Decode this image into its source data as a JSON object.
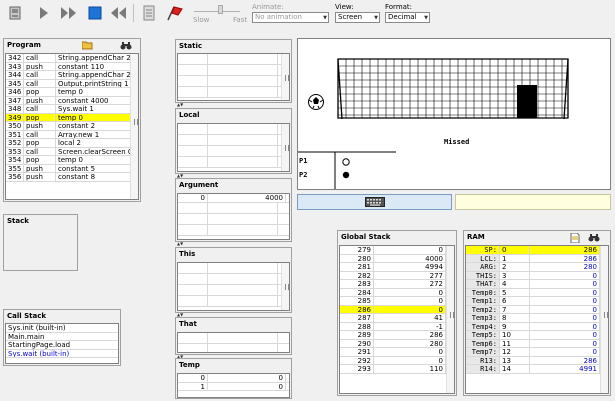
{
  "toolbar": {
    "buttons": [
      {
        "name": "load-program-button",
        "icon": "load-icon"
      },
      {
        "name": "single-step-button",
        "icon": "step-icon"
      },
      {
        "name": "fast-forward-button",
        "icon": "fast-forward-icon"
      },
      {
        "name": "stop-button",
        "icon": "stop-icon"
      },
      {
        "name": "rewind-button",
        "icon": "rewind-icon"
      },
      {
        "name": "script-button",
        "icon": "script-icon"
      },
      {
        "name": "breakpoints-button",
        "icon": "flag-icon"
      }
    ],
    "slow_label": "Slow",
    "fast_label": "Fast",
    "animate_label": "Animate:",
    "animate_value": "No animation",
    "view_label": "View:",
    "view_value": "Screen",
    "format_label": "Format:",
    "format_value": "Decimal"
  },
  "program": {
    "title": "Program",
    "rows": [
      {
        "n": "342",
        "cmd": "call",
        "arg": "String.appendChar 2",
        "hl": false
      },
      {
        "n": "343",
        "cmd": "push",
        "arg": "constant 110",
        "hl": false
      },
      {
        "n": "344",
        "cmd": "call",
        "arg": "String.appendChar 2",
        "hl": false
      },
      {
        "n": "345",
        "cmd": "call",
        "arg": "Output.printString 1",
        "hl": false
      },
      {
        "n": "346",
        "cmd": "pop",
        "arg": "temp 0",
        "hl": false
      },
      {
        "n": "347",
        "cmd": "push",
        "arg": "constant 4000",
        "hl": false
      },
      {
        "n": "348",
        "cmd": "call",
        "arg": "Sys.wait 1",
        "hl": false
      },
      {
        "n": "349",
        "cmd": "pop",
        "arg": "temp 0",
        "hl": true
      },
      {
        "n": "350",
        "cmd": "push",
        "arg": "constant 2",
        "hl": false
      },
      {
        "n": "351",
        "cmd": "call",
        "arg": "Array.new 1",
        "hl": false
      },
      {
        "n": "352",
        "cmd": "pop",
        "arg": "local 2",
        "hl": false
      },
      {
        "n": "353",
        "cmd": "call",
        "arg": "Screen.clearScreen 0",
        "hl": false
      },
      {
        "n": "354",
        "cmd": "pop",
        "arg": "temp 0",
        "hl": false
      },
      {
        "n": "355",
        "cmd": "push",
        "arg": "constant 5",
        "hl": false
      },
      {
        "n": "356",
        "cmd": "push",
        "arg": "constant 8",
        "hl": false
      }
    ]
  },
  "stack": {
    "title": "Stack"
  },
  "call_stack": {
    "title": "Call Stack",
    "items": [
      {
        "t": "Sys.init (built-in)",
        "blue": false
      },
      {
        "t": "Main.main",
        "blue": false
      },
      {
        "t": "StartingPage.load",
        "blue": false
      },
      {
        "t": "Sys.wait (built-in)",
        "blue": true
      }
    ]
  },
  "segments": {
    "static": {
      "title": "Static"
    },
    "local": {
      "title": "Local"
    },
    "argument": {
      "title": "Argument",
      "rows": [
        {
          "i": "0",
          "v": "4000"
        }
      ]
    },
    "this": {
      "title": "This"
    },
    "that": {
      "title": "That"
    },
    "temp": {
      "title": "Temp",
      "rows": [
        {
          "i": "0",
          "v": "0"
        },
        {
          "i": "1",
          "v": "0"
        }
      ]
    }
  },
  "screen": {
    "missed_text": "Missed",
    "p1_label": "P1",
    "p2_label": "P2"
  },
  "global_stack": {
    "title": "Global Stack",
    "rows": [
      {
        "a": "279",
        "v": "0",
        "hl": false
      },
      {
        "a": "280",
        "v": "4000",
        "hl": false
      },
      {
        "a": "281",
        "v": "4994",
        "hl": false
      },
      {
        "a": "282",
        "v": "277",
        "hl": false
      },
      {
        "a": "283",
        "v": "272",
        "hl": false
      },
      {
        "a": "284",
        "v": "0",
        "hl": false
      },
      {
        "a": "285",
        "v": "0",
        "hl": false
      },
      {
        "a": "286",
        "v": "0",
        "hl": true
      },
      {
        "a": "287",
        "v": "41",
        "hl": false
      },
      {
        "a": "288",
        "v": "-1",
        "hl": false
      },
      {
        "a": "289",
        "v": "286",
        "hl": false
      },
      {
        "a": "290",
        "v": "280",
        "hl": false
      },
      {
        "a": "291",
        "v": "0",
        "hl": false
      },
      {
        "a": "292",
        "v": "0",
        "hl": false
      },
      {
        "a": "293",
        "v": "110",
        "hl": false
      }
    ]
  },
  "ram": {
    "title": "RAM",
    "rows": [
      {
        "l": "SP:",
        "a": "0",
        "v": "286",
        "hl": true
      },
      {
        "l": "LCL:",
        "a": "1",
        "v": "286",
        "hl": false
      },
      {
        "l": "ARG:",
        "a": "2",
        "v": "280",
        "hl": false
      },
      {
        "l": "THIS:",
        "a": "3",
        "v": "0",
        "hl": false
      },
      {
        "l": "THAT:",
        "a": "4",
        "v": "0",
        "hl": false
      },
      {
        "l": "Temp0:",
        "a": "5",
        "v": "0",
        "hl": false
      },
      {
        "l": "Temp1:",
        "a": "6",
        "v": "0",
        "hl": false
      },
      {
        "l": "Temp2:",
        "a": "7",
        "v": "0",
        "hl": false
      },
      {
        "l": "Temp3:",
        "a": "8",
        "v": "0",
        "hl": false
      },
      {
        "l": "Temp4:",
        "a": "9",
        "v": "0",
        "hl": false
      },
      {
        "l": "Temp5:",
        "a": "10",
        "v": "0",
        "hl": false
      },
      {
        "l": "Temp6:",
        "a": "11",
        "v": "0",
        "hl": false
      },
      {
        "l": "Temp7:",
        "a": "12",
        "v": "0",
        "hl": false
      },
      {
        "l": "R13:",
        "a": "13",
        "v": "286",
        "hl": false
      },
      {
        "l": "R14:",
        "a": "14",
        "v": "4991",
        "hl": false
      }
    ]
  },
  "colors": {
    "highlight": "#ffff00",
    "value_blue": "#0000d0",
    "keyboard_bar": "#dbe8f5",
    "console_bg": "#ffffe0"
  }
}
